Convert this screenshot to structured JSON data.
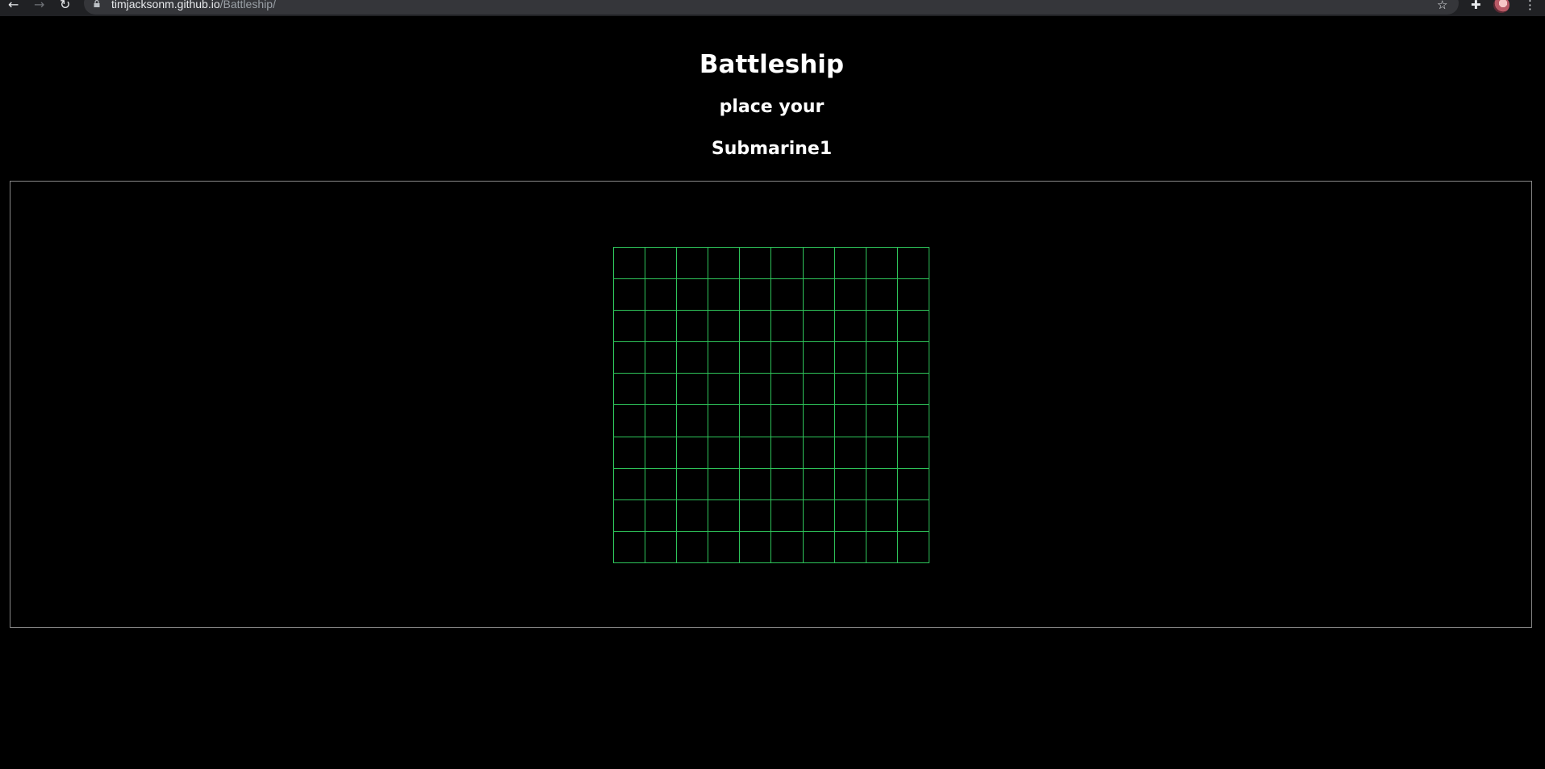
{
  "browser": {
    "url_host": "timjacksonm.github.io",
    "url_path": "/Battleship/",
    "icons": {
      "back": "←",
      "forward": "→",
      "reload": "↻",
      "lock": "🔒",
      "bookmark": "☆",
      "extensions": "✚",
      "menu": "⋮"
    }
  },
  "game": {
    "title": "Battleship",
    "prompt": "place your",
    "ship": "Submarine1"
  },
  "board": {
    "rows": 10,
    "cols": 10,
    "line_color": "#2ec45a"
  }
}
